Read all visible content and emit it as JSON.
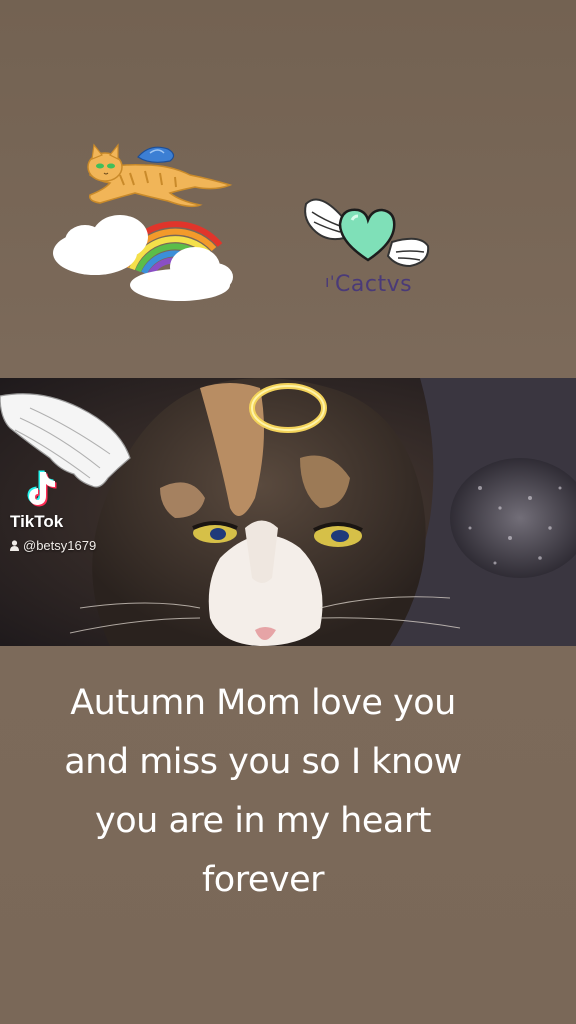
{
  "stickers": {
    "rainbow_cat": "rainbow-flying-cat-sticker",
    "angel_heart": "winged-heart-sticker",
    "halo": "halo-sticker",
    "wing": "angel-wing-sticker"
  },
  "sticker_credit": "Cactvs",
  "watermark": {
    "app_name": "TikTok",
    "username": "@betsy1679"
  },
  "caption": {
    "lines": [
      "Autumn Mom love you",
      "and miss you so I know",
      "you are in my heart",
      "forever"
    ]
  },
  "colors": {
    "background": "#7b6959",
    "caption_text": "#ffffff",
    "heart": "#7fe0b8",
    "halo": "#f3d35a"
  }
}
